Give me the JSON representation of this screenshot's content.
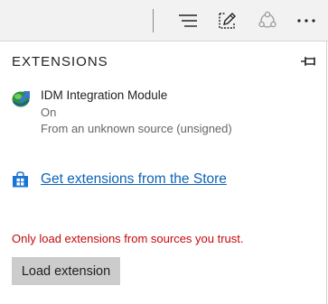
{
  "toolbar": {
    "buttons": [
      {
        "name": "hub",
        "icon": "hub-lines-icon"
      },
      {
        "name": "web-note",
        "icon": "web-note-pen-icon"
      },
      {
        "name": "share",
        "icon": "share-icon"
      },
      {
        "name": "more",
        "icon": "more-dots-icon"
      }
    ]
  },
  "panel": {
    "title": "EXTENSIONS",
    "pin_icon": "pin-icon"
  },
  "extensions": [
    {
      "name": "IDM Integration Module",
      "status": "On",
      "source": "From an unknown source (unsigned)",
      "icon": "idm-globe-icon"
    }
  ],
  "store": {
    "icon": "store-bag-icon",
    "link_text": "Get extensions from the Store"
  },
  "warning": {
    "text": "Only load extensions from sources you trust.",
    "color": "#c4080a"
  },
  "load_button": {
    "label": "Load extension"
  },
  "colors": {
    "link": "#0c63b8",
    "toolbar_bg": "#f2f2f2",
    "button_bg": "#cccccc"
  }
}
